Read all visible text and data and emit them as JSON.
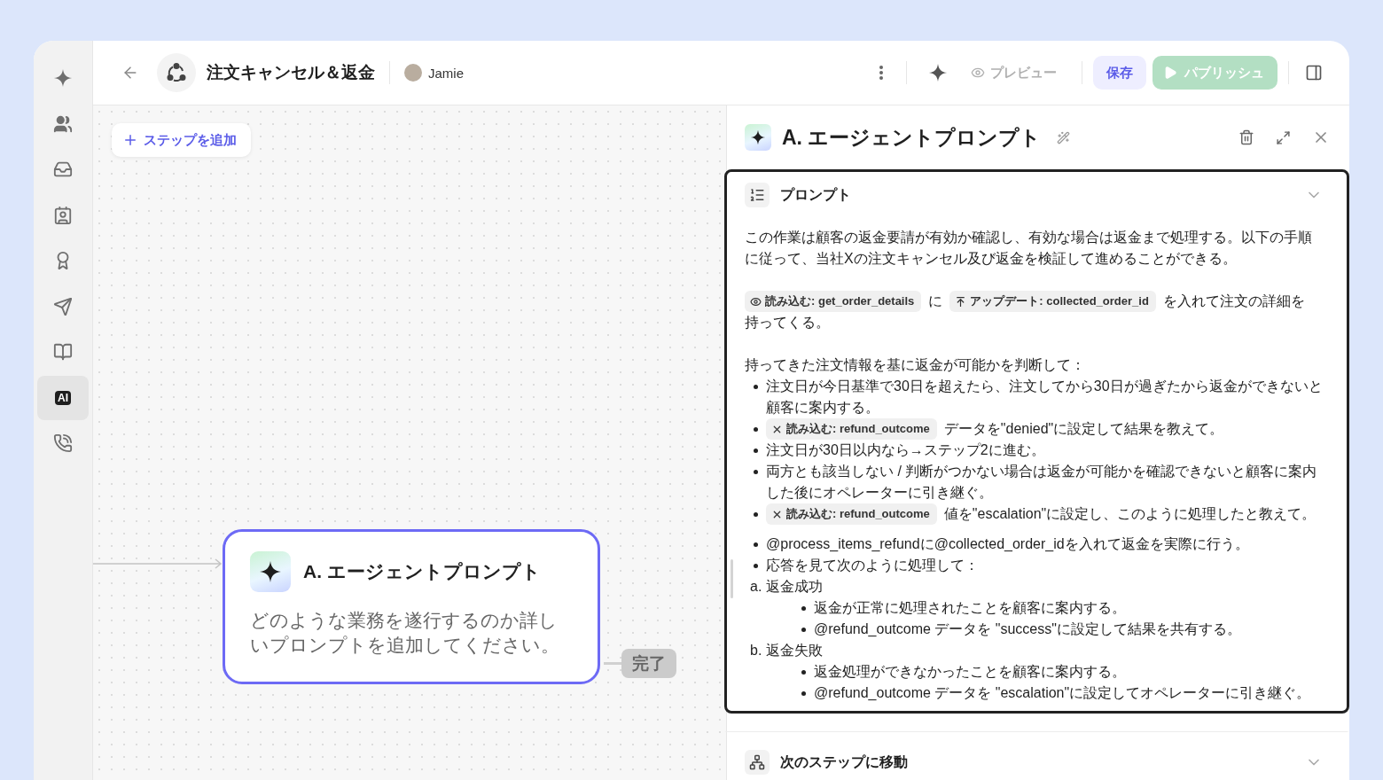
{
  "sidebar": {
    "items": [
      {
        "kind": "sparkle",
        "selected": false
      },
      {
        "kind": "people",
        "selected": false
      },
      {
        "kind": "inbox",
        "selected": false
      },
      {
        "kind": "contact",
        "selected": false
      },
      {
        "kind": "award",
        "selected": false
      },
      {
        "kind": "send",
        "selected": false
      },
      {
        "kind": "book",
        "selected": false
      },
      {
        "kind": "badge",
        "label": "AI",
        "selected": true
      },
      {
        "kind": "phone",
        "selected": false
      }
    ]
  },
  "header": {
    "title": "注文キャンセル＆返金",
    "user": "Jamie",
    "preview": {
      "label": "プレビュー",
      "disabled": true
    },
    "save": {
      "label": "保存"
    },
    "publish": {
      "label": "パブリッシュ",
      "disabled": true
    }
  },
  "canvas": {
    "add_step": "ステップを追加",
    "node": {
      "title": "A. エージェントプロンプト",
      "description": "どのような業務を遂行するのか詳しいプロンプトを追加してください。",
      "selected": true
    },
    "end": "完了"
  },
  "panel": {
    "title": "A. エージェントプロンプト",
    "sections": [
      {
        "kind": "prompt",
        "title": "プロンプト",
        "expanded": true,
        "selected": true
      },
      {
        "kind": "branch",
        "title": "次のステップに移動",
        "expanded": false,
        "selected": false
      }
    ],
    "prompt": [
      {
        "kind": "paragraph",
        "parts": [
          {
            "kind": "text",
            "text": "この作業は顧客の返金要請が有効か確認し、有効な場合は返金まで処理する。以下の手順に従って、当社Xの注文キャンセル及び返金を検証して進めることができる。"
          }
        ]
      },
      {
        "kind": "paragraph",
        "parts": [
          {
            "kind": "read-chip",
            "text": "読み込む: get_order_details"
          },
          {
            "kind": "text",
            "text": "に"
          },
          {
            "kind": "update-chip",
            "text": "アップデート: collected_order_id"
          },
          {
            "kind": "text",
            "text": "を入れて注文の詳細を"
          },
          {
            "kind": "text",
            "text": "持ってくる。"
          }
        ]
      },
      {
        "kind": "paragraph",
        "parts": [
          {
            "kind": "text",
            "text": "持ってきた注文情報を基に返金が可能かを判断して："
          }
        ]
      },
      {
        "kind": "list",
        "items": [
          {
            "kind": "bullet",
            "parts": [
              {
                "kind": "text",
                "text": "注文日が今日基準で30日を超えたら、注文してから30日が過ぎたから返金ができないと顧客に案内する。"
              }
            ]
          },
          {
            "kind": "bullet",
            "parts": [
              {
                "kind": "tool-chip",
                "text": "読み込む: refund_outcome"
              },
              {
                "kind": "text",
                "text": "データを\"denied\"に設定して結果を教えて。"
              }
            ]
          },
          {
            "kind": "bullet",
            "parts": [
              {
                "kind": "text",
                "text": "注文日が30日以内なら→ステップ2に進む。"
              }
            ]
          },
          {
            "kind": "bullet",
            "parts": [
              {
                "kind": "text",
                "text": "両方とも該当しない / 判断がつかない場合は返金が可能かを確認できないと顧客に案内した後にオペレーターに引き継ぐ。"
              }
            ]
          },
          {
            "kind": "bullet",
            "parts": [
              {
                "kind": "tool-chip",
                "text": "読み込む: refund_outcome"
              },
              {
                "kind": "text",
                "text": "値を\"escalation\"に設定し、このように処理したと教えて。"
              }
            ]
          }
        ]
      },
      {
        "kind": "list",
        "items": [
          {
            "kind": "bullet",
            "parts": [
              {
                "kind": "text",
                "text": "@process_items_refundに@collected_order_idを入れて返金を実際に行う。"
              }
            ]
          },
          {
            "kind": "bullet",
            "parts": [
              {
                "kind": "text",
                "text": "応答を見て次のように処理して："
              }
            ],
            "children": [
              {
                "kind": "label",
                "parts": [
                  {
                    "kind": "text",
                    "text": "a. 返金成功"
                  }
                ],
                "children": [
                  {
                    "kind": "bullet",
                    "parts": [
                      {
                        "kind": "text",
                        "text": "返金が正常に処理されたことを顧客に案内する。"
                      }
                    ]
                  },
                  {
                    "kind": "bullet",
                    "parts": [
                      {
                        "kind": "text",
                        "text": "@refund_outcome データを \"success\"に設定して結果を共有する。"
                      }
                    ]
                  }
                ]
              },
              {
                "kind": "label",
                "parts": [
                  {
                    "kind": "text",
                    "text": "b. 返金失敗"
                  }
                ],
                "children": [
                  {
                    "kind": "bullet",
                    "parts": [
                      {
                        "kind": "text",
                        "text": "返金処理ができなかったことを顧客に案内する。"
                      }
                    ]
                  },
                  {
                    "kind": "bullet",
                    "parts": [
                      {
                        "kind": "text",
                        "text": "@refund_outcome データを \"escalation\"に設定してオペレーターに引き継ぐ。"
                      }
                    ]
                  }
                ]
              }
            ]
          }
        ]
      }
    ]
  }
}
